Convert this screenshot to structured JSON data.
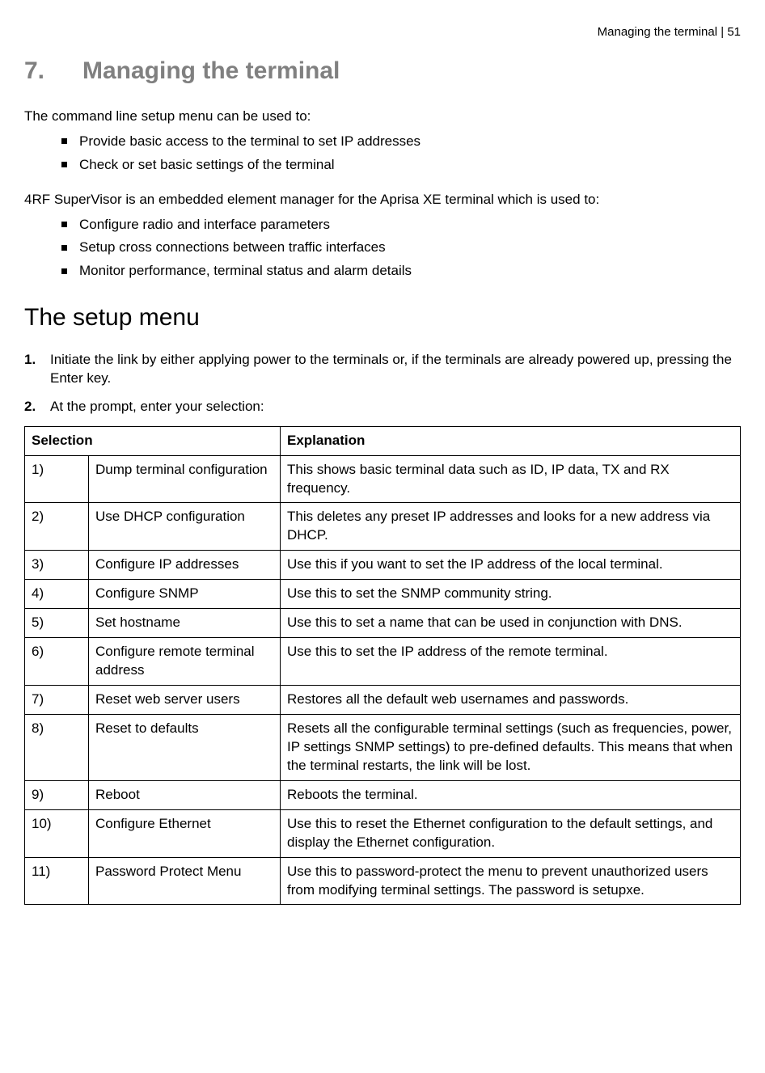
{
  "header": {
    "title": "Managing the terminal",
    "sep": "  |  ",
    "page": "51"
  },
  "chapter": {
    "number": "7.",
    "title": "Managing the terminal"
  },
  "intro1": "The command line setup menu can be used to:",
  "list1": [
    "Provide basic access to the terminal to set IP addresses",
    "Check or set basic settings of the terminal"
  ],
  "intro2": "4RF SuperVisor is an embedded element manager for the Aprisa XE terminal which is used to:",
  "list2": [
    "Configure radio and interface parameters",
    "Setup cross connections between traffic interfaces",
    "Monitor performance, terminal status and alarm details"
  ],
  "section": "The setup menu",
  "steps": [
    {
      "n": "1.",
      "text": "Initiate the link by either applying power to the terminals or, if the terminals are already powered up, pressing the Enter key."
    },
    {
      "n": "2.",
      "text": "At the prompt, enter your selection:"
    }
  ],
  "table": {
    "head": {
      "sel": "Selection",
      "exp": "Explanation"
    },
    "rows": [
      {
        "idx": "1)",
        "name": "Dump terminal configuration",
        "exp": "This shows basic terminal data such as ID, IP data, TX and RX frequency."
      },
      {
        "idx": "2)",
        "name": "Use DHCP configuration",
        "exp": "This deletes any preset IP addresses and looks for a new address via DHCP."
      },
      {
        "idx": "3)",
        "name": "Configure IP addresses",
        "exp": "Use this if you want to set the IP address of the local terminal."
      },
      {
        "idx": "4)",
        "name": "Configure SNMP",
        "exp": "Use this to set the SNMP community string."
      },
      {
        "idx": "5)",
        "name": "Set hostname",
        "exp": "Use this to set a name that can be used in conjunction with DNS."
      },
      {
        "idx": "6)",
        "name": "Configure remote terminal address",
        "exp": "Use this to set the IP address of the remote terminal."
      },
      {
        "idx": "7)",
        "name": "Reset web server users",
        "exp": "Restores all the default web usernames and passwords."
      },
      {
        "idx": "8)",
        "name": "Reset to defaults",
        "exp": "Resets all the configurable terminal settings (such as frequencies, power, IP settings SNMP settings) to pre-defined defaults. This means that when the terminal restarts, the link will be lost."
      },
      {
        "idx": "9)",
        "name": "Reboot",
        "exp": "Reboots the terminal."
      },
      {
        "idx": "10)",
        "name": "Configure Ethernet",
        "exp": "Use this to reset the Ethernet configuration to the default settings, and display the Ethernet configuration."
      },
      {
        "idx": "11)",
        "name": "Password Protect Menu",
        "exp": "Use this to password-protect the menu to prevent unauthorized users from modifying terminal settings. The password is setupxe."
      }
    ]
  }
}
